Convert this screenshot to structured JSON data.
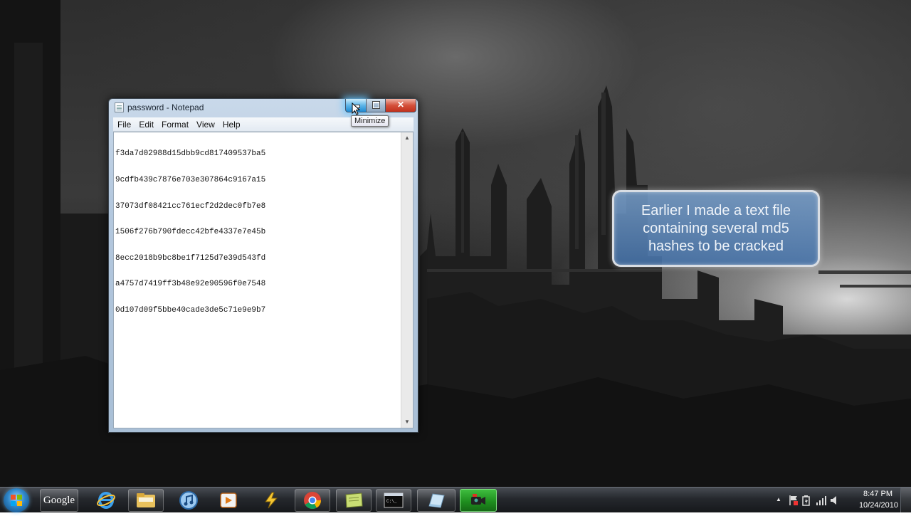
{
  "window": {
    "title": "password - Notepad",
    "tooltip": "Minimize",
    "close_glyph": "✕",
    "icons": {
      "app": "notepad-icon",
      "minimize": "minimize-icon",
      "maximize": "maximize-icon",
      "close": "close-icon"
    }
  },
  "menu": {
    "items": [
      "File",
      "Edit",
      "Format",
      "View",
      "Help"
    ]
  },
  "editor": {
    "lines": [
      "f3da7d02988d15dbb9cd817409537ba5",
      "9cdfb439c7876e703e307864c9167a15",
      "37073df08421cc761ecf2d2dec0fb7e8",
      "1506f276b790fdecc42bfe4337e7e45b",
      "8ecc2018b9bc8be1f7125d7e39d543fd",
      "a4757d7419ff3b48e92e90596f0e7548",
      "0d107d09f5bbe40cade3de5c71e9e9b7"
    ]
  },
  "callout": {
    "lines": [
      "Earlier I made a text file",
      "containing several md5",
      "hashes to be cracked"
    ]
  },
  "taskbar": {
    "google_label": "Google",
    "items": [
      {
        "name": "internet-explorer",
        "icon": "ie-icon"
      },
      {
        "name": "windows-explorer",
        "icon": "folder-icon"
      },
      {
        "name": "itunes",
        "icon": "itunes-icon"
      },
      {
        "name": "media-player",
        "icon": "media-player-icon"
      },
      {
        "name": "app-yellow",
        "icon": "lightning-icon"
      },
      {
        "name": "chrome",
        "icon": "chrome-icon"
      },
      {
        "name": "notes",
        "icon": "sticky-note-icon"
      },
      {
        "name": "command-prompt",
        "icon": "cmd-icon",
        "text": "C:\\_"
      },
      {
        "name": "notepad",
        "icon": "notepad-icon"
      },
      {
        "name": "camtasia-recorder",
        "icon": "video-camera-icon"
      }
    ],
    "clock": {
      "time": "8:47 PM",
      "date": "10/24/2010"
    },
    "colors": {
      "recording_button": "#1f8f1f",
      "start_orb": "#2f86c8"
    }
  }
}
